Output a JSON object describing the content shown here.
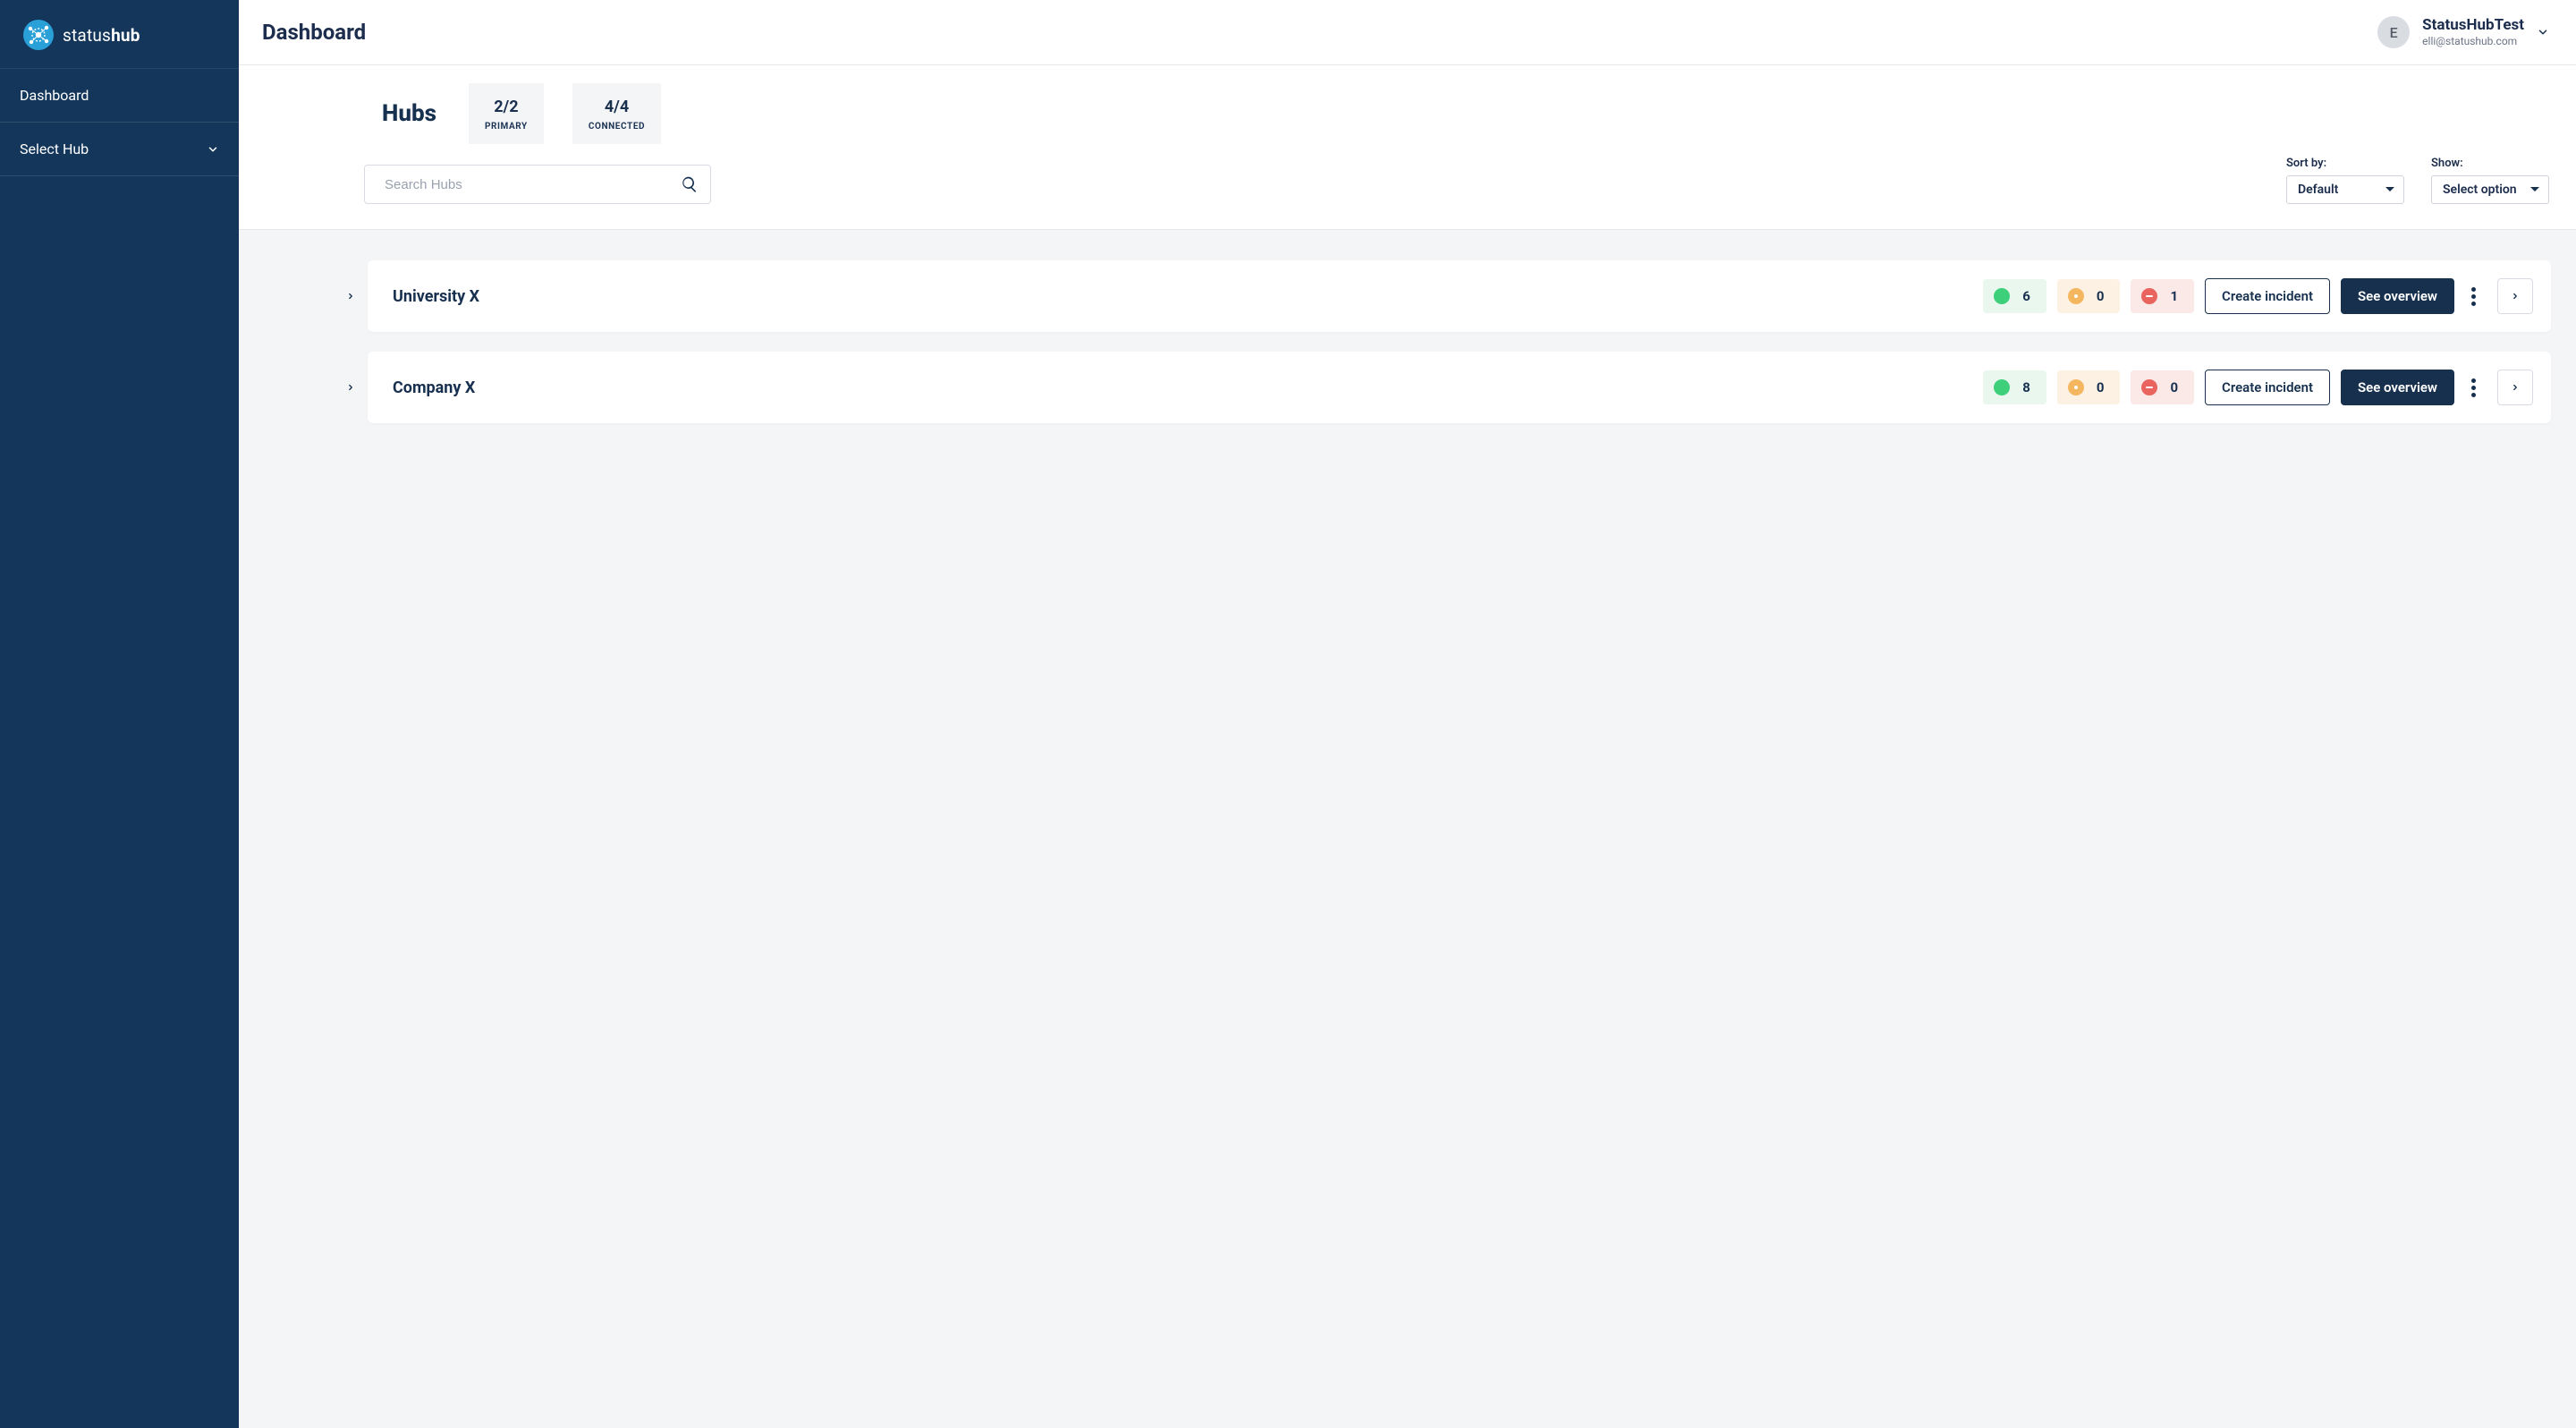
{
  "brand": {
    "name_light": "status",
    "name_bold": "hub"
  },
  "sidebar": {
    "items": [
      {
        "label": "Dashboard"
      },
      {
        "label": "Select Hub"
      }
    ]
  },
  "header": {
    "title": "Dashboard",
    "account": {
      "avatar_initial": "E",
      "name": "StatusHubTest",
      "email": "elli@statushub.com"
    }
  },
  "summary": {
    "heading": "Hubs",
    "primary": {
      "value": "2/2",
      "label": "PRIMARY"
    },
    "connected": {
      "value": "4/4",
      "label": "CONNECTED"
    }
  },
  "search": {
    "placeholder": "Search Hubs"
  },
  "controls": {
    "sort": {
      "label": "Sort by:",
      "value": "Default"
    },
    "show": {
      "label": "Show:",
      "value": "Select option"
    }
  },
  "hubs": [
    {
      "name": "University X",
      "status": {
        "green": "6",
        "orange": "0",
        "red": "1"
      },
      "create_incident_label": "Create incident",
      "overview_label": "See overview"
    },
    {
      "name": "Company X",
      "status": {
        "green": "8",
        "orange": "0",
        "red": "0"
      },
      "create_incident_label": "Create incident",
      "overview_label": "See overview"
    }
  ]
}
